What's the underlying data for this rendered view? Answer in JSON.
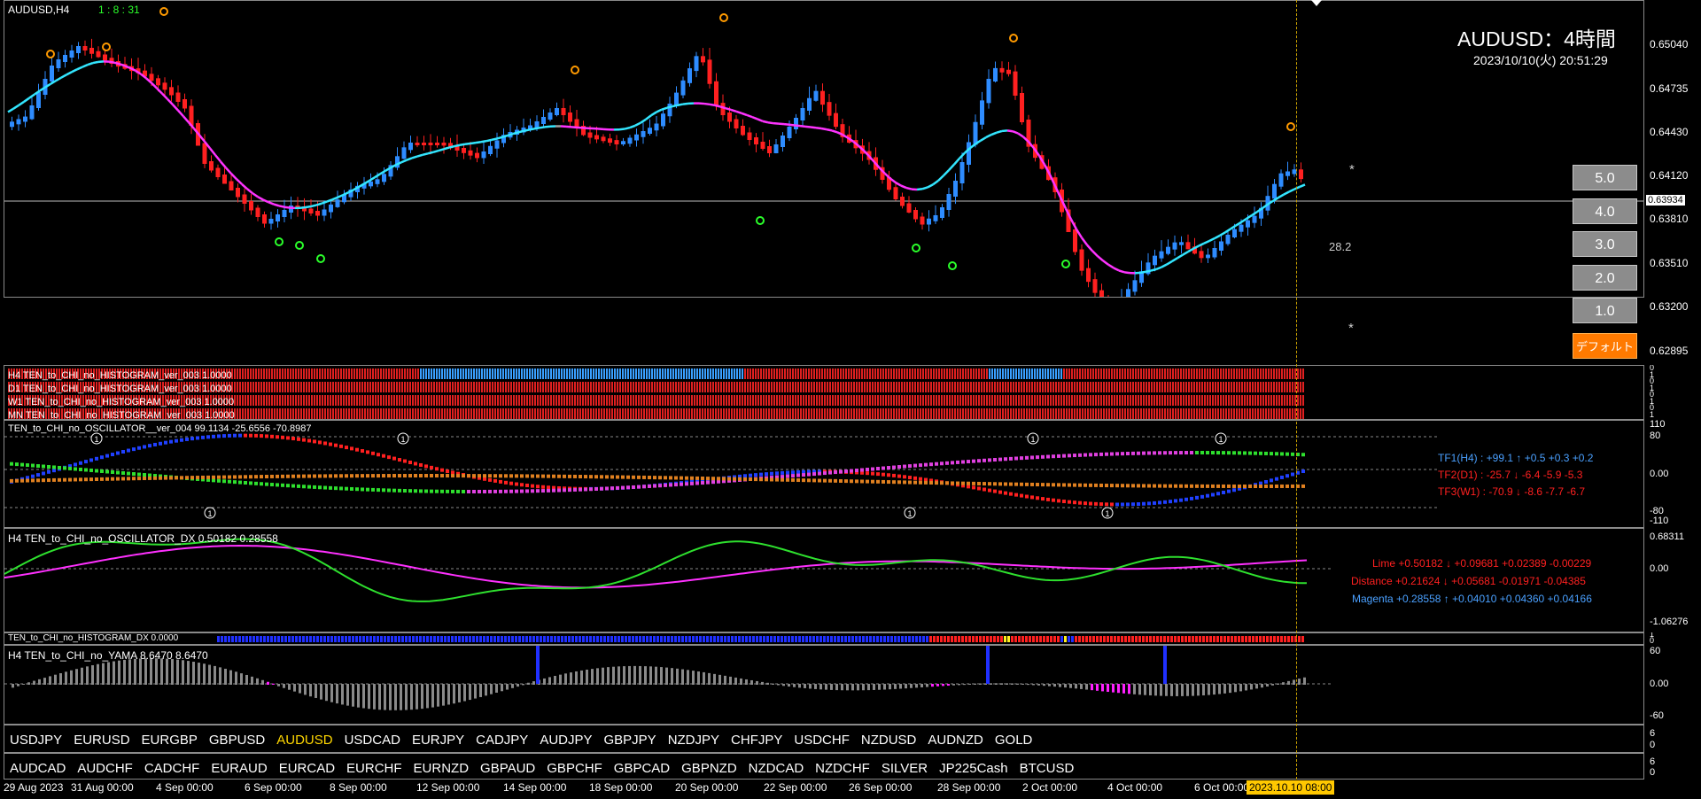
{
  "colors": {
    "bull": "#2e8cff",
    "bear": "#ff2020",
    "ma_pink": "#ff33ff",
    "ma_cyan": "#33e6ff",
    "ma_gray": "#a0a0a0",
    "orange_marker": "#ff9a00",
    "green_marker": "#2aff2a",
    "hist_red": "#e02020",
    "hist_blue": "#3aa0ff",
    "osc_green": "#2ee02e",
    "osc_magenta": "#ff30ff",
    "now_line": "#c8a000",
    "highlight_date_bg": "#ffc800"
  },
  "chart": {
    "symbol_label": "AUDUSD,H4",
    "timer": "1 : 8 : 31",
    "title": "AUDUSD：4時間",
    "datetime": "2023/10/10(火) 20:51:29",
    "price_axis": [
      "0.65040",
      "0.64735",
      "0.64430",
      "0.64120",
      "0.63810",
      "0.63510",
      "0.63200",
      "0.62895"
    ],
    "current_price": "0.63934",
    "annotation": "28.2",
    "star": "*",
    "level_buttons": [
      "5.0",
      "4.0",
      "3.0",
      "2.0",
      "1.0"
    ],
    "default_button": "デフォルト"
  },
  "histograms": [
    {
      "label": "H4  TEN_to_CHI_no_HISTOGRAM_ver_003 1.0000"
    },
    {
      "label": "D1  TEN_to_CHI_no_HISTOGRAM_ver_003 1.0000"
    },
    {
      "label": "W1  TEN_to_CHI_no_HISTOGRAM_ver_003 1.0000"
    },
    {
      "label": "MN  TEN_to_CHI_no_HISTOGRAM_ver_003 1.0000"
    }
  ],
  "hist_axis": [
    "0",
    "1",
    "0",
    "1",
    "0",
    "1",
    "0",
    "1"
  ],
  "oscillator": {
    "label": "TEN_to_CHI_no_OSCILLATOR__ver_004 99.1134 -25.6556 -70.8987",
    "axis": [
      "110",
      "80",
      "0.00",
      "-80",
      "-110"
    ],
    "tf1": "TF1(H4) : +99.1  ↑  +0.5  +0.3  +0.2",
    "tf2": "TF2(D1) : -25.7  ↓  -6.4  -5.9  -5.3",
    "tf3": "TF3(W1) : -70.9  ↓  -8.6  -7.7  -6.7",
    "marker": "1"
  },
  "dx": {
    "label": "H4  TEN_to_CHI_no_OSCILLATOR_DX  0.50182  0.28558",
    "axis": [
      "0.68311",
      "0.00",
      "-1.06276"
    ],
    "lime": "Lime +0.50182 ↓ +0.09681  +0.02389  -0.00229",
    "distance": "Distance +0.21624 ↓ +0.05681  -0.01971  -0.04385",
    "magenta": "Magenta +0.28558 ↑ +0.04010  +0.04360  +0.04166"
  },
  "hist_dx": {
    "label": "TEN_to_CHI_no_HISTOGRAM_DX 0.0000",
    "axis": [
      "1",
      "0"
    ]
  },
  "yama": {
    "label": "H4  TEN_to_CHI_no_YAMA  8.6470  8.6470",
    "axis": [
      "60",
      "0.00",
      "-60"
    ]
  },
  "symbols_row1": [
    "USDJPY",
    "EURUSD",
    "EURGBP",
    "GBPUSD",
    "AUDUSD",
    "USDCAD",
    "EURJPY",
    "CADJPY",
    "AUDJPY",
    "GBPJPY",
    "NZDJPY",
    "CHFJPY",
    "USDCHF",
    "NZDUSD",
    "AUDNZD",
    "GOLD"
  ],
  "active_symbol": "AUDUSD",
  "symbols_row2": [
    "AUDCAD",
    "AUDCHF",
    "CADCHF",
    "EURAUD",
    "EURCAD",
    "EURCHF",
    "EURNZD",
    "GBPAUD",
    "GBPCHF",
    "GBPCAD",
    "GBPNZD",
    "NZDCAD",
    "NZDCHF",
    "SILVER",
    "JP225Cash",
    "BTCUSD"
  ],
  "row_axis": [
    "6",
    "0"
  ],
  "time_axis": [
    "29 Aug 2023",
    "31 Aug 00:00",
    "4 Sep 00:00",
    "6 Sep 00:00",
    "8 Sep 00:00",
    "12 Sep 00:00",
    "14 Sep 00:00",
    "18 Sep 00:00",
    "20 Sep 00:00",
    "22 Sep 00:00",
    "26 Sep 00:00",
    "28 Sep 00:00",
    "2 Oct 00:00",
    "4 Oct 00:00",
    "6 Oct 00:00"
  ],
  "time_highlight": "2023.10.10 08:00"
}
